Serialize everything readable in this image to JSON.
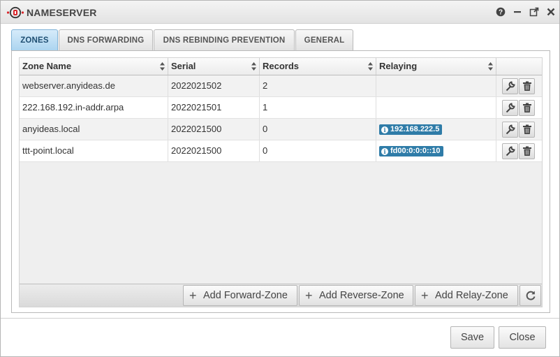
{
  "window": {
    "title": "NAMESERVER"
  },
  "titlebar_icons": [
    "help-icon",
    "minimize-icon",
    "popout-icon",
    "close-icon"
  ],
  "tabs": [
    {
      "label": "ZONES",
      "active": true
    },
    {
      "label": "DNS FORWARDING",
      "active": false
    },
    {
      "label": "DNS REBINDING PREVENTION",
      "active": false
    },
    {
      "label": "GENERAL",
      "active": false
    }
  ],
  "grid": {
    "columns": [
      "Zone Name",
      "Serial",
      "Records",
      "Relaying"
    ],
    "rows": [
      {
        "zone_name": "webserver.anyideas.de",
        "serial": "2022021502",
        "records": "2",
        "relaying": ""
      },
      {
        "zone_name": "222.168.192.in-addr.arpa",
        "serial": "2022021501",
        "records": "1",
        "relaying": ""
      },
      {
        "zone_name": "anyideas.local",
        "serial": "2022021500",
        "records": "0",
        "relaying": "192.168.222.5"
      },
      {
        "zone_name": "ttt-point.local",
        "serial": "2022021500",
        "records": "0",
        "relaying": "fd00:0:0:0::10"
      }
    ],
    "row_actions": [
      "edit-icon",
      "delete-icon"
    ]
  },
  "footer": {
    "add_forward_zone": "Add Forward-Zone",
    "add_reverse_zone": "Add Reverse-Zone",
    "add_relay_zone": "Add Relay-Zone"
  },
  "buttons": {
    "save": "Save",
    "close": "Close"
  },
  "colors": {
    "active_tab": "#a9d3ef",
    "badge": "#2f7ca8",
    "logo_red": "#d9262b"
  }
}
